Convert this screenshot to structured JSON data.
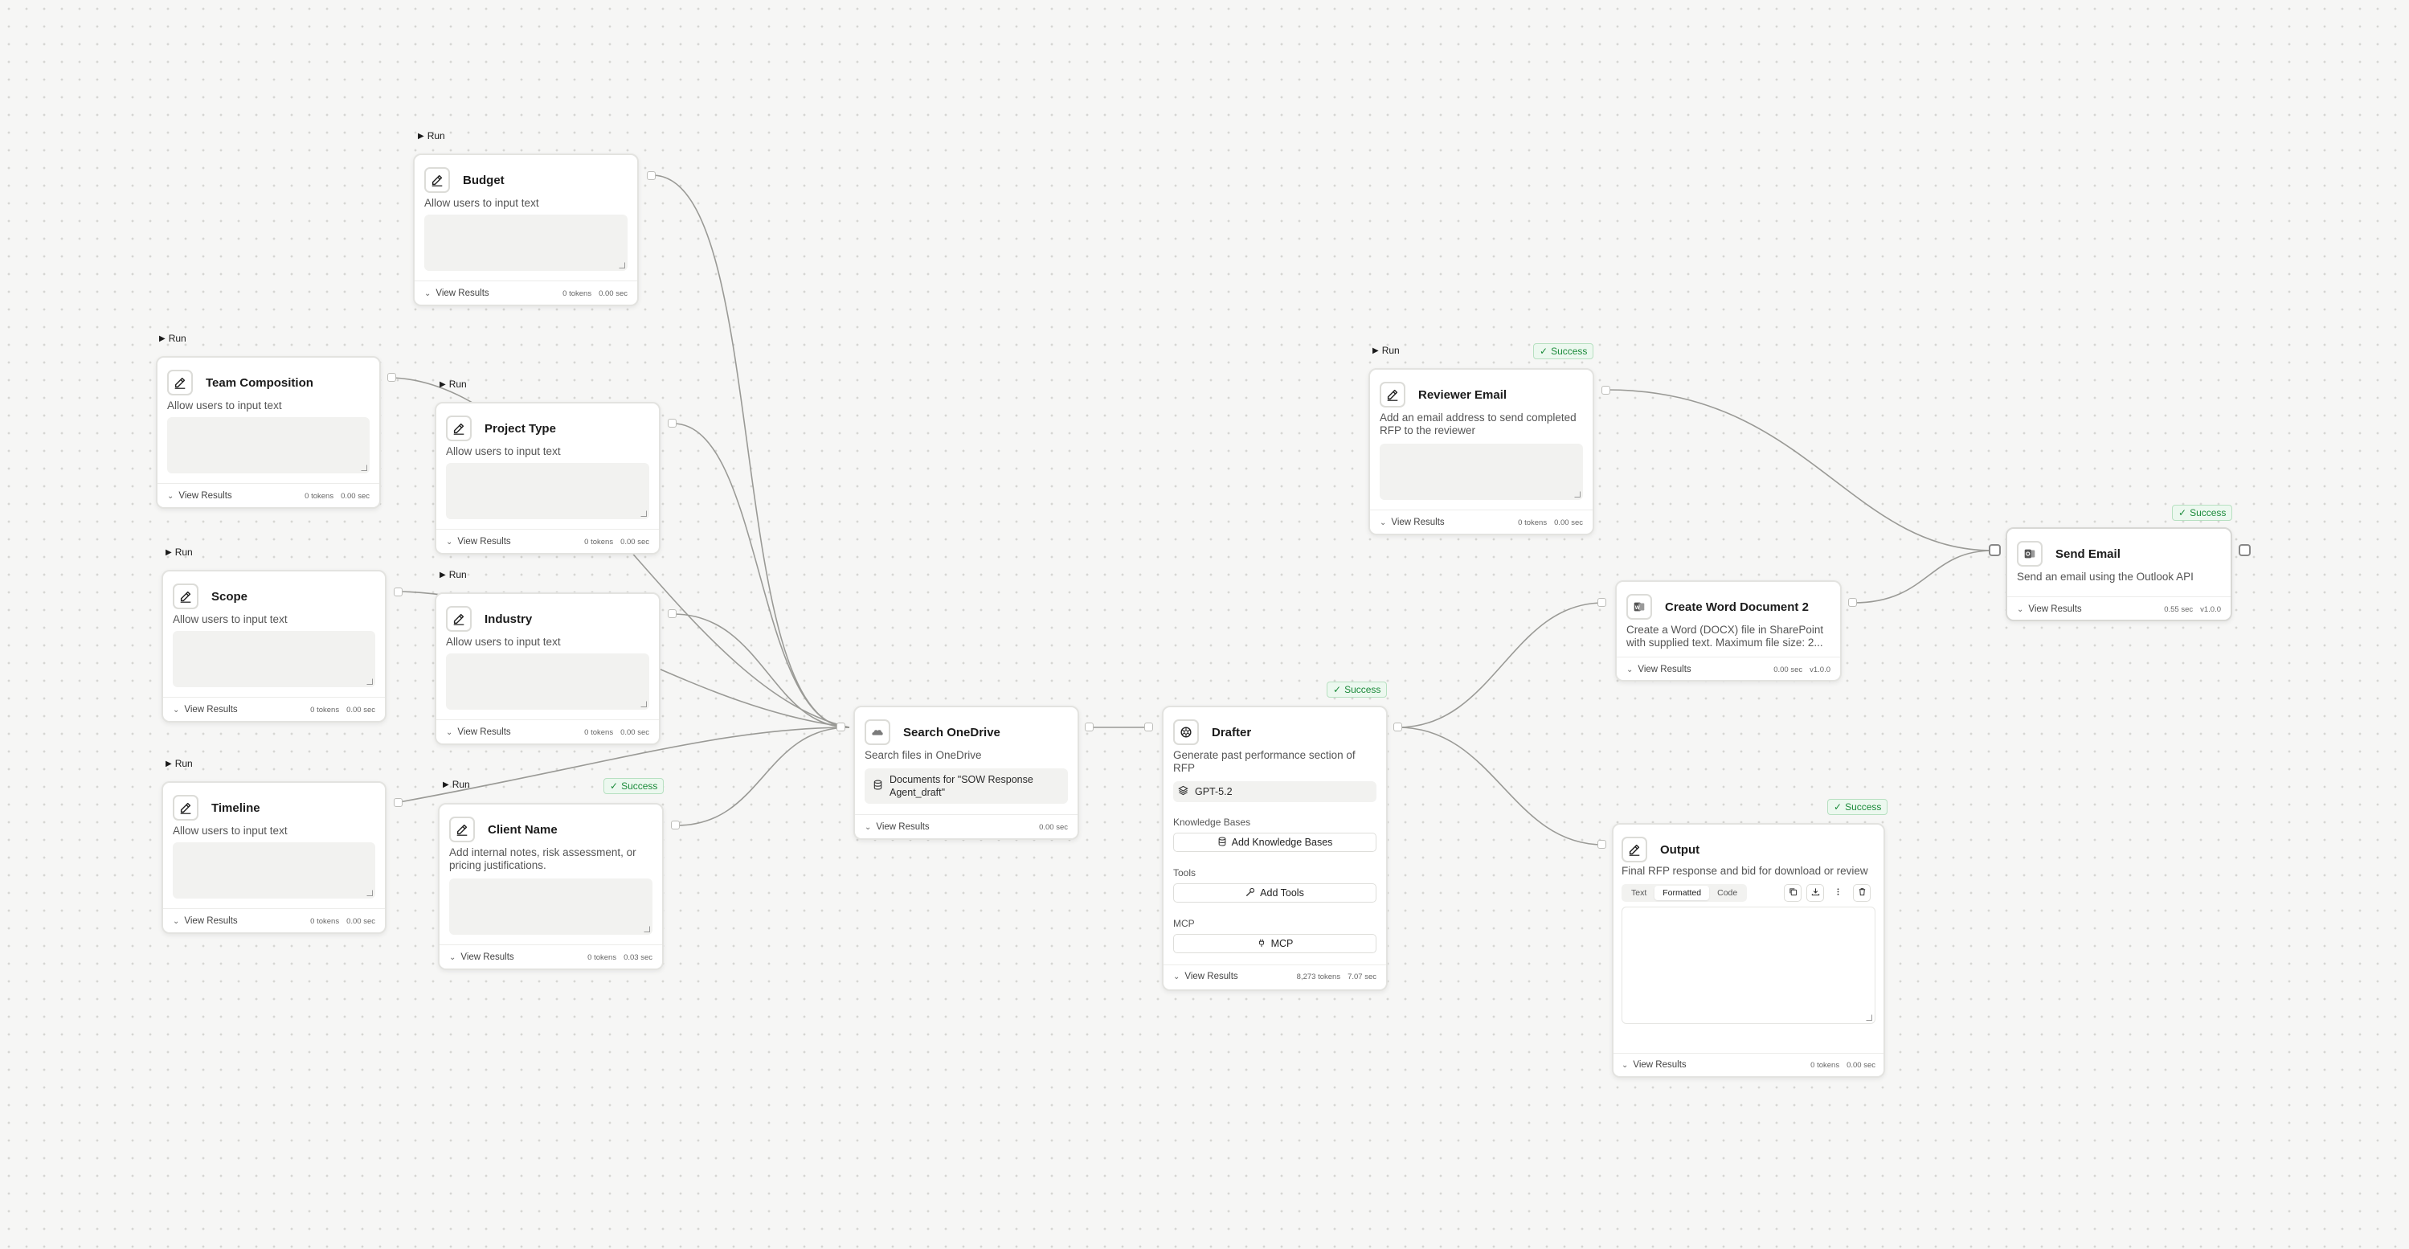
{
  "common": {
    "run_label": "Run",
    "view_results": "View Results",
    "success": "Success",
    "input_desc": "Allow users to input text"
  },
  "nodes": {
    "budget": {
      "title": "Budget",
      "tokens": "0 tokens",
      "time": "0.00 sec"
    },
    "team": {
      "title": "Team Composition",
      "tokens": "0 tokens",
      "time": "0.00 sec"
    },
    "project_type": {
      "title": "Project Type",
      "tokens": "0 tokens",
      "time": "0.00 sec"
    },
    "scope": {
      "title": "Scope",
      "tokens": "0 tokens",
      "time": "0.00 sec"
    },
    "industry": {
      "title": "Industry",
      "tokens": "0 tokens",
      "time": "0.00 sec"
    },
    "timeline": {
      "title": "Timeline",
      "tokens": "0 tokens",
      "time": "0.00 sec"
    },
    "client_name": {
      "title": "Client Name",
      "desc": "Add internal notes, risk assessment, or pricing justifications.",
      "tokens": "0 tokens",
      "time": "0.03 sec"
    },
    "search_onedrive": {
      "title": "Search OneDrive",
      "desc": "Search files in OneDrive",
      "chip": "Documents for \"SOW Response Agent_draft\"",
      "time": "0.00 sec"
    },
    "drafter": {
      "title": "Drafter",
      "desc": "Generate past performance section of RFP",
      "model": "GPT-5.2",
      "kb_label": "Knowledge Bases",
      "kb_button": "Add Knowledge Bases",
      "tools_label": "Tools",
      "tools_button": "Add Tools",
      "mcp_label": "MCP",
      "mcp_button": "MCP",
      "tokens": "8,273 tokens",
      "time": "7.07 sec"
    },
    "reviewer_email": {
      "title": "Reviewer Email",
      "desc": "Add an email address to send completed RFP to the reviewer",
      "tokens": "0 tokens",
      "time": "0.00 sec"
    },
    "create_word": {
      "title": "Create Word Document 2",
      "desc": "Create a Word (DOCX) file in SharePoint with supplied text. Maximum file size: 2...",
      "time": "0.00 sec",
      "version": "v1.0.0"
    },
    "send_email": {
      "title": "Send Email",
      "desc": "Send an email using the Outlook API",
      "time": "0.55 sec",
      "version": "v1.0.0"
    },
    "output": {
      "title": "Output",
      "desc": "Final RFP response and bid for download or review",
      "tabs": [
        "Text",
        "Formatted",
        "Code"
      ],
      "active_tab": "Formatted",
      "tokens": "0 tokens",
      "time": "0.00 sec"
    }
  },
  "icons": {
    "pencil": "pencil-icon",
    "onedrive": "onedrive-icon",
    "openai": "openai-icon",
    "word": "word-icon",
    "outlook": "outlook-icon",
    "database": "database-icon",
    "wrench": "wrench-icon",
    "plug": "plug-icon",
    "copy": "copy-icon",
    "download": "download-icon",
    "more": "more-vertical-icon",
    "trash": "trash-icon"
  },
  "colors": {
    "success_text": "#1b8a3a",
    "success_bg": "#ecf8ef",
    "edge": "#9a9a96"
  }
}
